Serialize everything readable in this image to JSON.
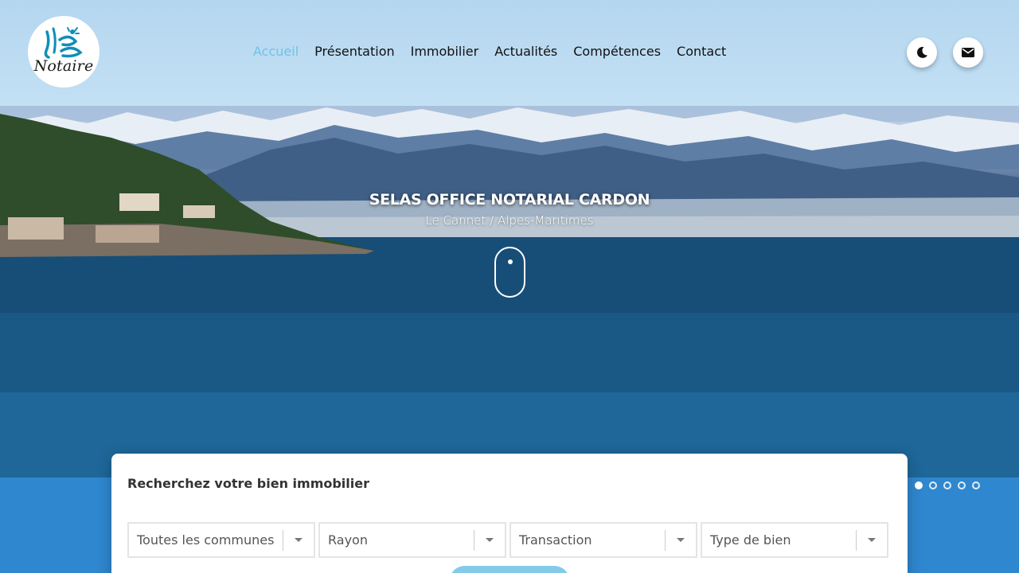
{
  "header": {
    "logo_text": "Notaire",
    "nav": [
      {
        "label": "Accueil",
        "active": true
      },
      {
        "label": "Présentation"
      },
      {
        "label": "Immobilier"
      },
      {
        "label": "Actualités"
      },
      {
        "label": "Compétences"
      },
      {
        "label": "Contact"
      }
    ],
    "theme_icon": "moon-icon",
    "mail_icon": "mail-icon"
  },
  "hero": {
    "title": "SELAS OFFICE NOTARIAL CARDON",
    "subtitle": "Le Cannet / Alpes-Maritimes",
    "scroll_icon": "mouse-scroll-icon"
  },
  "slider": {
    "count": 5,
    "active_index": 0
  },
  "search": {
    "title": "Recherchez votre bien immobilier",
    "fields": [
      {
        "label": "Toutes les communes"
      },
      {
        "label": "Rayon"
      },
      {
        "label": "Transaction"
      },
      {
        "label": "Type de bien"
      }
    ],
    "button_label": ""
  },
  "colors": {
    "accent": "#6fc3e6",
    "footer_bg": "#2f87cf",
    "header_bg": "#b4d6ef"
  }
}
